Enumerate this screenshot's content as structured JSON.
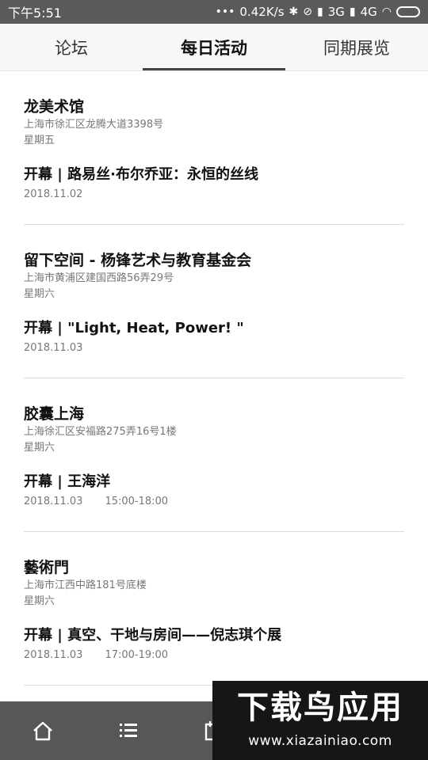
{
  "status_bar": {
    "time": "下午5:51",
    "speed": "0.42K/s",
    "net1": "3G",
    "net2": "4G"
  },
  "tabs": [
    {
      "label": "论坛"
    },
    {
      "label": "每日活动"
    },
    {
      "label": "同期展览"
    }
  ],
  "events": [
    {
      "venue": "龙美术馆",
      "address": "上海市徐汇区龙腾大道3398号",
      "weekday": "星期五",
      "title": "开幕 | 路易丝·布尔乔亚：永恒的丝线",
      "date": "2018.11.02",
      "time": ""
    },
    {
      "venue": "留下空间 - 杨锋艺术与教育基金会",
      "address": "上海市黄浦区建国西路56弄29号",
      "weekday": "星期六",
      "title": "开幕 | \"Light, Heat, Power! \"",
      "date": "2018.11.03",
      "time": ""
    },
    {
      "venue": "胶囊上海",
      "address": "上海徐汇区安福路275弄16号1楼",
      "weekday": "星期六",
      "title": "开幕 | 王海洋",
      "date": "2018.11.03",
      "time": "15:00-18:00"
    },
    {
      "venue": "藝術門",
      "address": "上海市江西中路181号底楼",
      "weekday": "星期六",
      "title": "开幕 | 真空、干地与房间——倪志琪个展",
      "date": "2018.11.03",
      "time": "17:00-19:00"
    }
  ],
  "bottom_nav": {
    "icons": [
      "home-icon",
      "list-icon",
      "calendar-icon"
    ]
  },
  "watermark": {
    "title": "下载鸟应用",
    "url": "www.xiazainiao.com"
  }
}
